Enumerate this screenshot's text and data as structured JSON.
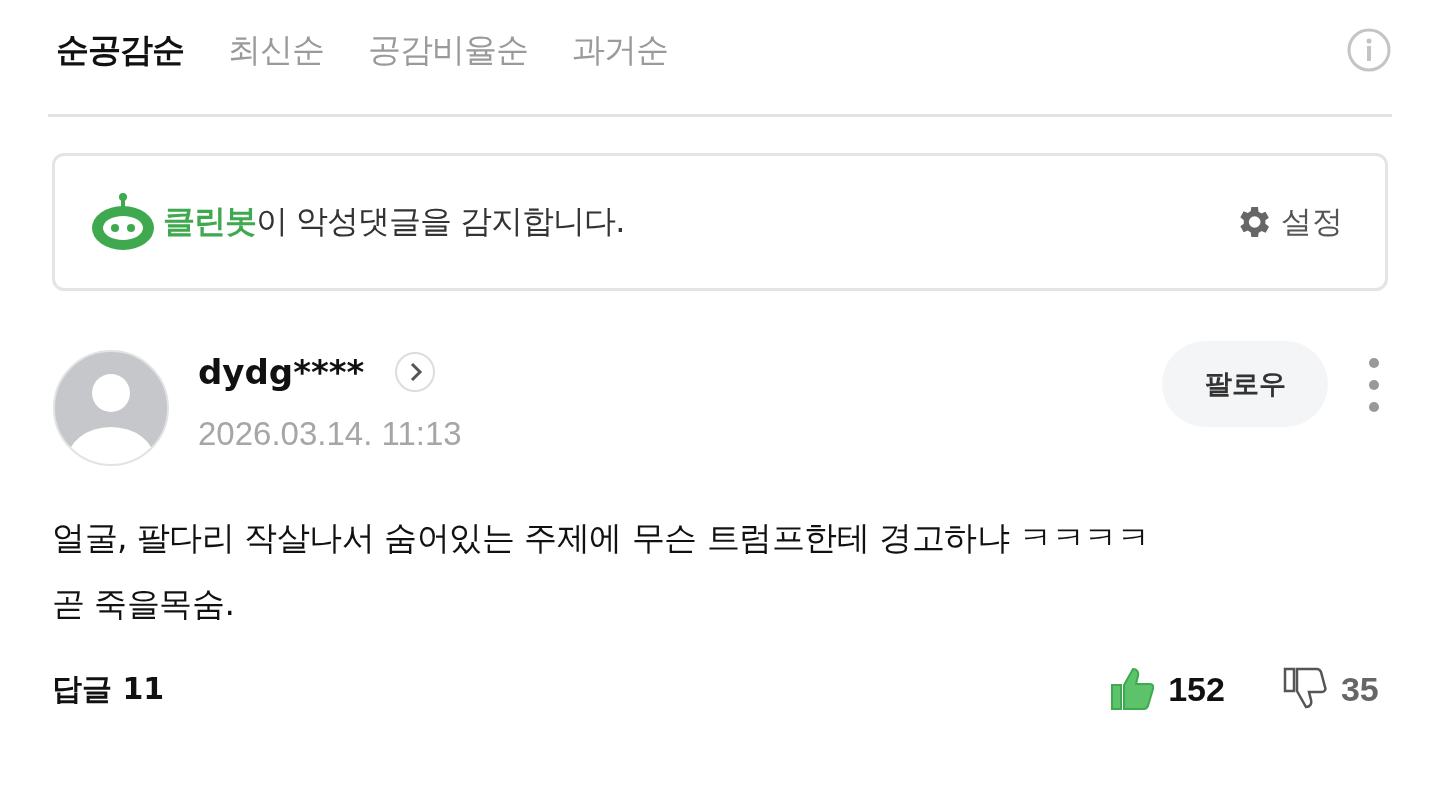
{
  "sort_tabs": [
    {
      "label": "순공감순",
      "selected": true
    },
    {
      "label": "최신순",
      "selected": false
    },
    {
      "label": "공감비율순",
      "selected": false
    },
    {
      "label": "과거순",
      "selected": false
    }
  ],
  "cleanbot": {
    "message": "**클린봇**이 악성댓글을 감지합니다.",
    "settings_label": "설정"
  },
  "comment": {
    "username": "dydg****",
    "date": "2026.03.14. 11:13",
    "follow_label": "팔로우",
    "text": "얼굴, 팔다리 작살나서 숨어있는 주제에 무슨 트럼프한테 경고하냐 ㅋㅋㅋㅋ 곧 죽을목숨.",
    "replies_label": "답글 11",
    "likes": "152",
    "liked": true,
    "dislikes": "35"
  }
}
